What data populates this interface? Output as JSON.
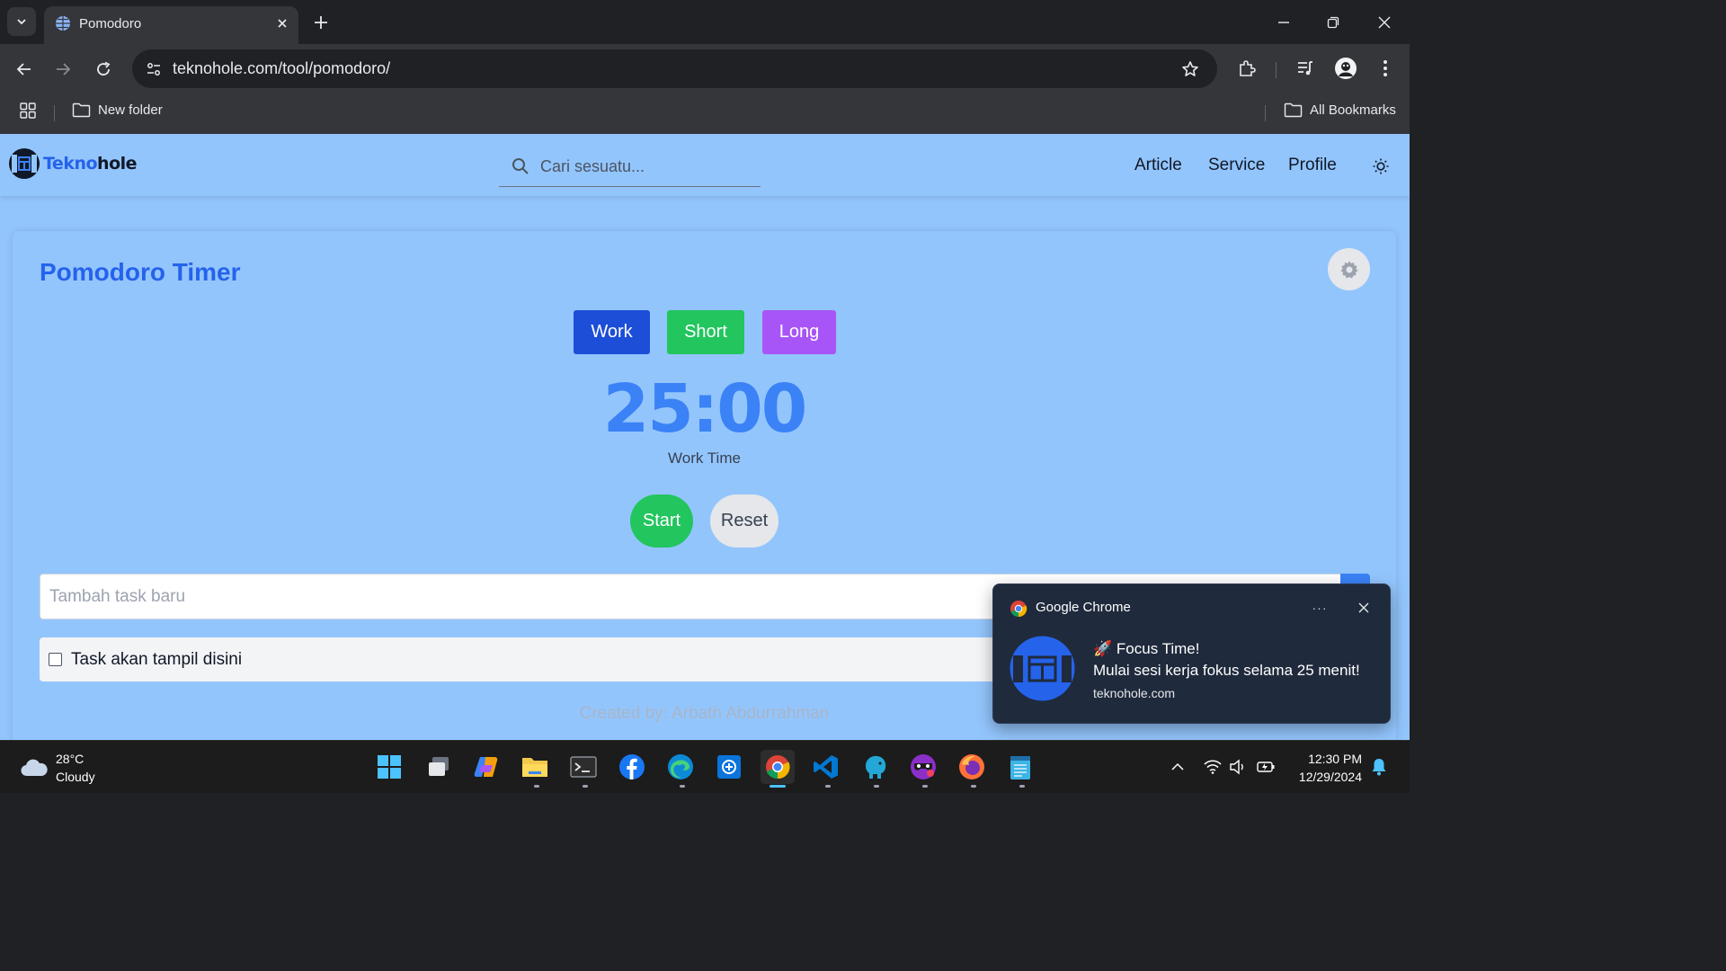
{
  "browser": {
    "tab_title": "Pomodoro",
    "url": "teknohole.com/tool/pomodoro/",
    "bookmarks": {
      "folder": "New folder",
      "all": "All Bookmarks"
    }
  },
  "site": {
    "logo_part1": "Tekno",
    "logo_part2": "hole",
    "search_placeholder": "Cari sesuatu...",
    "nav": [
      "Article",
      "Service",
      "Profile"
    ]
  },
  "pomodoro": {
    "title": "Pomodoro Timer",
    "modes": [
      {
        "label": "Work",
        "color": "#1d4ed8"
      },
      {
        "label": "Short",
        "color": "#22c55e"
      },
      {
        "label": "Long",
        "color": "#a855f7"
      }
    ],
    "time": "25:00",
    "mode_label": "Work Time",
    "start_label": "Start",
    "reset_label": "Reset",
    "task_placeholder": "Tambah task baru",
    "task_item": "Task akan tampil disini",
    "credit": "Created by: Arbath Abdurrahman"
  },
  "notification": {
    "app": "Google Chrome",
    "more": "···",
    "title_emoji": "🚀",
    "title": "Focus Time!",
    "body": "Mulai sesi kerja fokus selama 25 menit!",
    "source": "teknohole.com"
  },
  "taskbar": {
    "weather_temp": "28°C",
    "weather_desc": "Cloudy",
    "time": "12:30 PM",
    "date": "12/29/2024"
  },
  "colors": {
    "page_bg": "#93c5fd",
    "accent": "#2563eb",
    "timer": "#3b82f6"
  }
}
